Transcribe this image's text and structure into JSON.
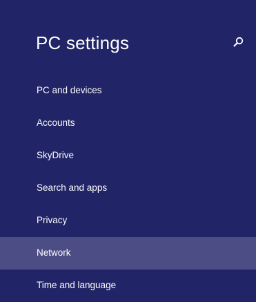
{
  "header": {
    "title": "PC settings",
    "search_icon": "search-icon"
  },
  "nav": {
    "selected": "Network",
    "items": [
      {
        "label": "PC and devices"
      },
      {
        "label": "Accounts"
      },
      {
        "label": "SkyDrive"
      },
      {
        "label": "Search and apps"
      },
      {
        "label": "Privacy"
      },
      {
        "label": "Network"
      },
      {
        "label": "Time and language"
      }
    ]
  },
  "colors": {
    "background": "#212466",
    "selected_background": "#4b4d84",
    "text": "#ffffff"
  }
}
